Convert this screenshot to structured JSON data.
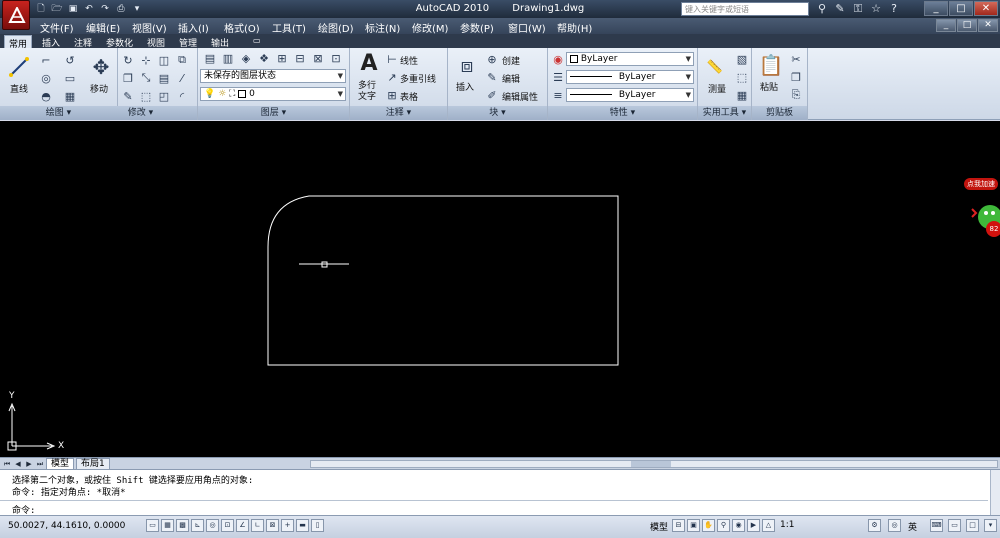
{
  "titlebar": {
    "app_name": "AutoCAD 2010",
    "file_name": "Drawing1.dwg",
    "search_placeholder": "键入关键字或短语",
    "window_buttons": [
      "_",
      "□",
      "✕"
    ]
  },
  "menubar": {
    "items": [
      "文件(F)",
      "编辑(E)",
      "视图(V)",
      "插入(I)",
      "格式(O)",
      "工具(T)",
      "绘图(D)",
      "标注(N)",
      "修改(M)",
      "参数(P)",
      "窗口(W)",
      "帮助(H)"
    ]
  },
  "ribbon_tabs": [
    "常用",
    "插入",
    "注释",
    "参数化",
    "视图",
    "管理",
    "输出"
  ],
  "ribbon": {
    "draw": {
      "title": "绘图",
      "line_label": "直线"
    },
    "modify": {
      "title": "修改",
      "move_label": "移动"
    },
    "layers": {
      "title": "图层",
      "layer_state": "未保存的图层状态",
      "current_layer": "0"
    },
    "annotation": {
      "title": "注释",
      "mtext_label": "多行",
      "mtext_label2": "文字",
      "linear_label": "线性",
      "mleader_label": "多重引线",
      "table_label": "表格"
    },
    "block": {
      "title": "块",
      "insert_label": "插入",
      "create_label": "创建",
      "edit_label": "编辑",
      "edit_attr_label": "编辑属性"
    },
    "properties": {
      "title": "特性",
      "color": "ByLayer",
      "linetype": "ByLayer",
      "lineweight": "ByLayer"
    },
    "utilities": {
      "title": "实用工具",
      "measure_label": "测量"
    },
    "clipboard": {
      "title": "剪贴板",
      "paste_label": "粘贴"
    }
  },
  "canvas": {
    "axis_x": "X",
    "axis_y": "Y",
    "badge_text": "点我加速",
    "badge_number": "82"
  },
  "layout_tabs": [
    "模型",
    "布局1"
  ],
  "command": {
    "line1": "选择第二个对象，或按住 Shift 键选择要应用角点的对象:",
    "line2": "命令: 指定对角点: *取消*",
    "prompt": "命令:"
  },
  "status": {
    "coords": "50.0027, 44.1610, 0.0000",
    "model_label": "模型",
    "scale_label": "1:1",
    "ime_label": "英"
  }
}
